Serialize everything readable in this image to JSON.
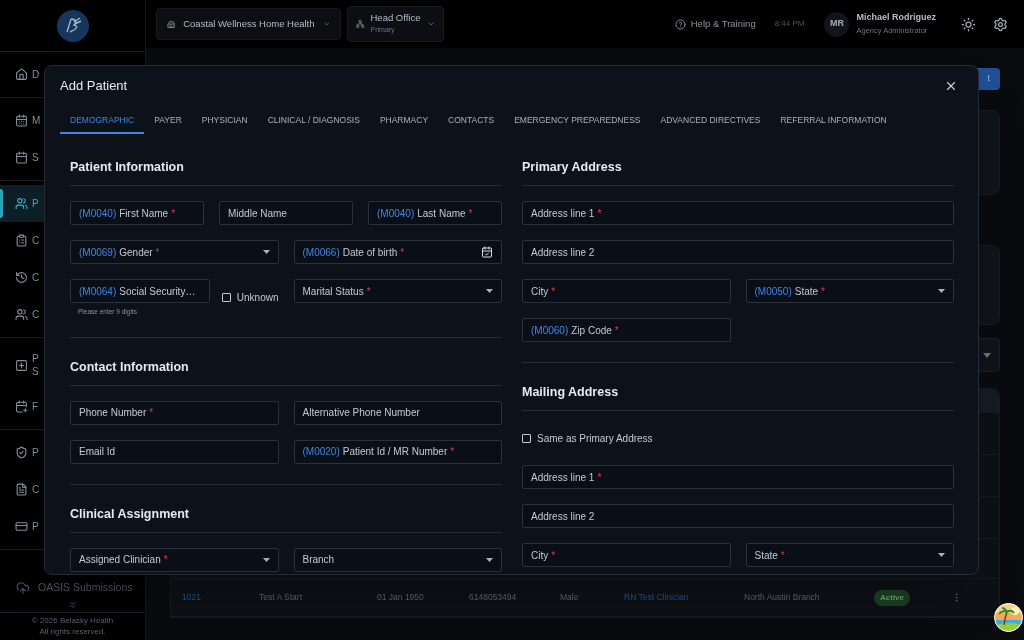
{
  "sidebar": {
    "groups": [
      [
        {
          "label": "D",
          "selected": false
        }
      ],
      [
        {
          "label": "M",
          "selected": false
        },
        {
          "label": "S",
          "selected": false
        }
      ],
      [
        {
          "label": "P",
          "selected": true
        },
        {
          "label": "C",
          "selected": false
        },
        {
          "label": "C",
          "selected": false
        },
        {
          "label": "C",
          "selected": false
        }
      ],
      [
        {
          "label": "P",
          "label_2": "S",
          "selected": false
        },
        {
          "label": "F",
          "selected": false
        }
      ],
      [
        {
          "label": "P",
          "selected": false
        },
        {
          "label": "C",
          "selected": false
        },
        {
          "label": "P",
          "selected": false
        }
      ]
    ],
    "bottom_item": "OASIS Submissions",
    "copyright": "© 2026 Belasky Health",
    "rights": "All rights reserved."
  },
  "topbar": {
    "organization": "Coastal Wellness Home Health",
    "office": {
      "name": "Head Office",
      "sub": "Primary"
    },
    "help": "Help & Training",
    "time": "8:44 PM",
    "user": {
      "initials": "MR",
      "name": "Michael Rodriguez",
      "role": "Agency Administrator"
    }
  },
  "background": {
    "button": "t",
    "rows": [
      {
        "id": "1021",
        "name": "Test A Start",
        "dob": "01 Jan 1950",
        "phone": "6148053494",
        "gender": "Male",
        "clinician": "RN Test Clinician",
        "branch": "North Austin Branch",
        "status": "Active"
      }
    ]
  },
  "modal": {
    "title": "Add Patient",
    "tabs": [
      {
        "label": "DEMOGRAPHIC",
        "selected": true
      },
      {
        "label": "PAYER",
        "selected": false
      },
      {
        "label": "PHYSICIAN",
        "selected": false
      },
      {
        "label": "CLINICAL / DIAGNOSIS",
        "selected": false
      },
      {
        "label": "PHARMACY",
        "selected": false
      },
      {
        "label": "CONTACTS",
        "selected": false
      },
      {
        "label": "EMERGENCY PREPAREDNESS",
        "selected": false
      },
      {
        "label": "ADVANCED DIRECTIVES",
        "selected": false
      },
      {
        "label": "REFERRAL INFORMATION",
        "selected": false
      }
    ],
    "columns": [
      [
        {
          "title": "Patient Information",
          "rows": [
            [
              {
                "kind": "text",
                "code": "(M0040)",
                "label": "First Name",
                "mark": "*"
              },
              {
                "kind": "text",
                "label": "Middle Name"
              },
              {
                "kind": "text",
                "code": "(M0040)",
                "label": "Last Name",
                "mark": "*"
              }
            ],
            [
              {
                "kind": "select",
                "code": "(M0069)",
                "label": "Gender",
                "mark": "*"
              },
              {
                "kind": "date",
                "code": "(M0066)",
                "label": "Date of birth",
                "mark": "*"
              }
            ],
            [
              {
                "kind": "text",
                "code": "(M0064)",
                "label": "Social Security…",
                "helper": "Please enter 9 digits"
              },
              {
                "kind": "checkbox",
                "label": "Unknown",
                "checked": false
              },
              {
                "kind": "select",
                "label": "Marital Status",
                "mark": "*"
              }
            ]
          ]
        },
        {
          "title": "Contact Information",
          "rows": [
            [
              {
                "kind": "text",
                "label": "Phone Number",
                "mark": "*"
              },
              {
                "kind": "text",
                "label": "Alternative Phone Number"
              }
            ],
            [
              {
                "kind": "text",
                "label": "Email Id"
              },
              {
                "kind": "text",
                "code": "(M0020)",
                "label": "Patient Id / MR Number",
                "mark": "*"
              }
            ]
          ]
        },
        {
          "title": "Clinical Assignment",
          "rows": [
            [
              {
                "kind": "select",
                "label": "Assigned Clinician",
                "mark": "*"
              },
              {
                "kind": "select",
                "label": "Branch"
              }
            ]
          ]
        }
      ],
      [
        {
          "title": "Primary Address",
          "rows": [
            [
              {
                "kind": "text",
                "label": "Address line 1",
                "mark": "*"
              }
            ],
            [
              {
                "kind": "text",
                "label": "Address line 2"
              }
            ],
            [
              {
                "kind": "text",
                "label": "City",
                "mark": "*"
              },
              {
                "kind": "select",
                "code": "(M0050)",
                "label": "State",
                "mark": "*"
              }
            ],
            [
              {
                "kind": "text",
                "code": "(M0060)",
                "label": "Zip Code",
                "mark": "*"
              },
              {
                "kind": "empty"
              }
            ]
          ]
        },
        {
          "title": "Mailing Address",
          "rows": [
            [
              {
                "kind": "checkbox",
                "label": "Same as Primary Address",
                "checked": false
              }
            ],
            [
              {
                "kind": "text",
                "label": "Address line 1",
                "mark": "*"
              }
            ],
            [
              {
                "kind": "text",
                "label": "Address line 2"
              }
            ],
            [
              {
                "kind": "text",
                "label": "City",
                "mark": "*"
              },
              {
                "kind": "select",
                "label": "State",
                "mark": "*"
              }
            ]
          ]
        }
      ]
    ]
  }
}
